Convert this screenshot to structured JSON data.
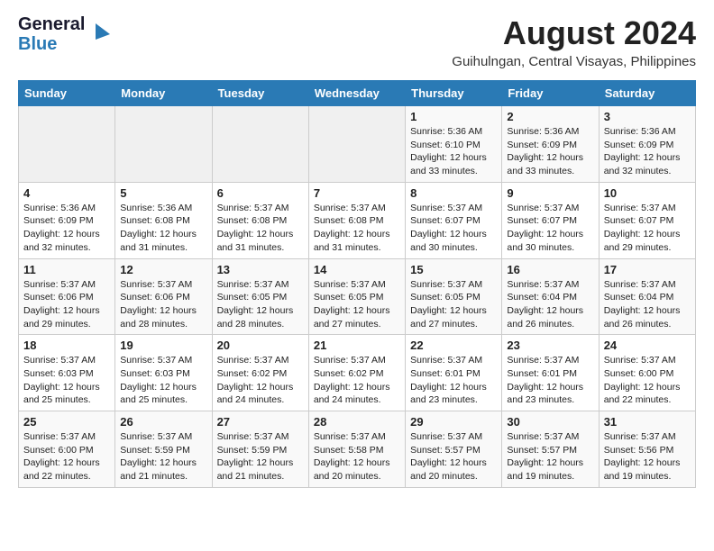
{
  "header": {
    "logo_general": "General",
    "logo_blue": "Blue",
    "month_year": "August 2024",
    "location": "Guihulngan, Central Visayas, Philippines"
  },
  "weekdays": [
    "Sunday",
    "Monday",
    "Tuesday",
    "Wednesday",
    "Thursday",
    "Friday",
    "Saturday"
  ],
  "weeks": [
    [
      {
        "day": "",
        "info": ""
      },
      {
        "day": "",
        "info": ""
      },
      {
        "day": "",
        "info": ""
      },
      {
        "day": "",
        "info": ""
      },
      {
        "day": "1",
        "info": "Sunrise: 5:36 AM\nSunset: 6:10 PM\nDaylight: 12 hours\nand 33 minutes."
      },
      {
        "day": "2",
        "info": "Sunrise: 5:36 AM\nSunset: 6:09 PM\nDaylight: 12 hours\nand 33 minutes."
      },
      {
        "day": "3",
        "info": "Sunrise: 5:36 AM\nSunset: 6:09 PM\nDaylight: 12 hours\nand 32 minutes."
      }
    ],
    [
      {
        "day": "4",
        "info": "Sunrise: 5:36 AM\nSunset: 6:09 PM\nDaylight: 12 hours\nand 32 minutes."
      },
      {
        "day": "5",
        "info": "Sunrise: 5:36 AM\nSunset: 6:08 PM\nDaylight: 12 hours\nand 31 minutes."
      },
      {
        "day": "6",
        "info": "Sunrise: 5:37 AM\nSunset: 6:08 PM\nDaylight: 12 hours\nand 31 minutes."
      },
      {
        "day": "7",
        "info": "Sunrise: 5:37 AM\nSunset: 6:08 PM\nDaylight: 12 hours\nand 31 minutes."
      },
      {
        "day": "8",
        "info": "Sunrise: 5:37 AM\nSunset: 6:07 PM\nDaylight: 12 hours\nand 30 minutes."
      },
      {
        "day": "9",
        "info": "Sunrise: 5:37 AM\nSunset: 6:07 PM\nDaylight: 12 hours\nand 30 minutes."
      },
      {
        "day": "10",
        "info": "Sunrise: 5:37 AM\nSunset: 6:07 PM\nDaylight: 12 hours\nand 29 minutes."
      }
    ],
    [
      {
        "day": "11",
        "info": "Sunrise: 5:37 AM\nSunset: 6:06 PM\nDaylight: 12 hours\nand 29 minutes."
      },
      {
        "day": "12",
        "info": "Sunrise: 5:37 AM\nSunset: 6:06 PM\nDaylight: 12 hours\nand 28 minutes."
      },
      {
        "day": "13",
        "info": "Sunrise: 5:37 AM\nSunset: 6:05 PM\nDaylight: 12 hours\nand 28 minutes."
      },
      {
        "day": "14",
        "info": "Sunrise: 5:37 AM\nSunset: 6:05 PM\nDaylight: 12 hours\nand 27 minutes."
      },
      {
        "day": "15",
        "info": "Sunrise: 5:37 AM\nSunset: 6:05 PM\nDaylight: 12 hours\nand 27 minutes."
      },
      {
        "day": "16",
        "info": "Sunrise: 5:37 AM\nSunset: 6:04 PM\nDaylight: 12 hours\nand 26 minutes."
      },
      {
        "day": "17",
        "info": "Sunrise: 5:37 AM\nSunset: 6:04 PM\nDaylight: 12 hours\nand 26 minutes."
      }
    ],
    [
      {
        "day": "18",
        "info": "Sunrise: 5:37 AM\nSunset: 6:03 PM\nDaylight: 12 hours\nand 25 minutes."
      },
      {
        "day": "19",
        "info": "Sunrise: 5:37 AM\nSunset: 6:03 PM\nDaylight: 12 hours\nand 25 minutes."
      },
      {
        "day": "20",
        "info": "Sunrise: 5:37 AM\nSunset: 6:02 PM\nDaylight: 12 hours\nand 24 minutes."
      },
      {
        "day": "21",
        "info": "Sunrise: 5:37 AM\nSunset: 6:02 PM\nDaylight: 12 hours\nand 24 minutes."
      },
      {
        "day": "22",
        "info": "Sunrise: 5:37 AM\nSunset: 6:01 PM\nDaylight: 12 hours\nand 23 minutes."
      },
      {
        "day": "23",
        "info": "Sunrise: 5:37 AM\nSunset: 6:01 PM\nDaylight: 12 hours\nand 23 minutes."
      },
      {
        "day": "24",
        "info": "Sunrise: 5:37 AM\nSunset: 6:00 PM\nDaylight: 12 hours\nand 22 minutes."
      }
    ],
    [
      {
        "day": "25",
        "info": "Sunrise: 5:37 AM\nSunset: 6:00 PM\nDaylight: 12 hours\nand 22 minutes."
      },
      {
        "day": "26",
        "info": "Sunrise: 5:37 AM\nSunset: 5:59 PM\nDaylight: 12 hours\nand 21 minutes."
      },
      {
        "day": "27",
        "info": "Sunrise: 5:37 AM\nSunset: 5:59 PM\nDaylight: 12 hours\nand 21 minutes."
      },
      {
        "day": "28",
        "info": "Sunrise: 5:37 AM\nSunset: 5:58 PM\nDaylight: 12 hours\nand 20 minutes."
      },
      {
        "day": "29",
        "info": "Sunrise: 5:37 AM\nSunset: 5:57 PM\nDaylight: 12 hours\nand 20 minutes."
      },
      {
        "day": "30",
        "info": "Sunrise: 5:37 AM\nSunset: 5:57 PM\nDaylight: 12 hours\nand 19 minutes."
      },
      {
        "day": "31",
        "info": "Sunrise: 5:37 AM\nSunset: 5:56 PM\nDaylight: 12 hours\nand 19 minutes."
      }
    ]
  ]
}
